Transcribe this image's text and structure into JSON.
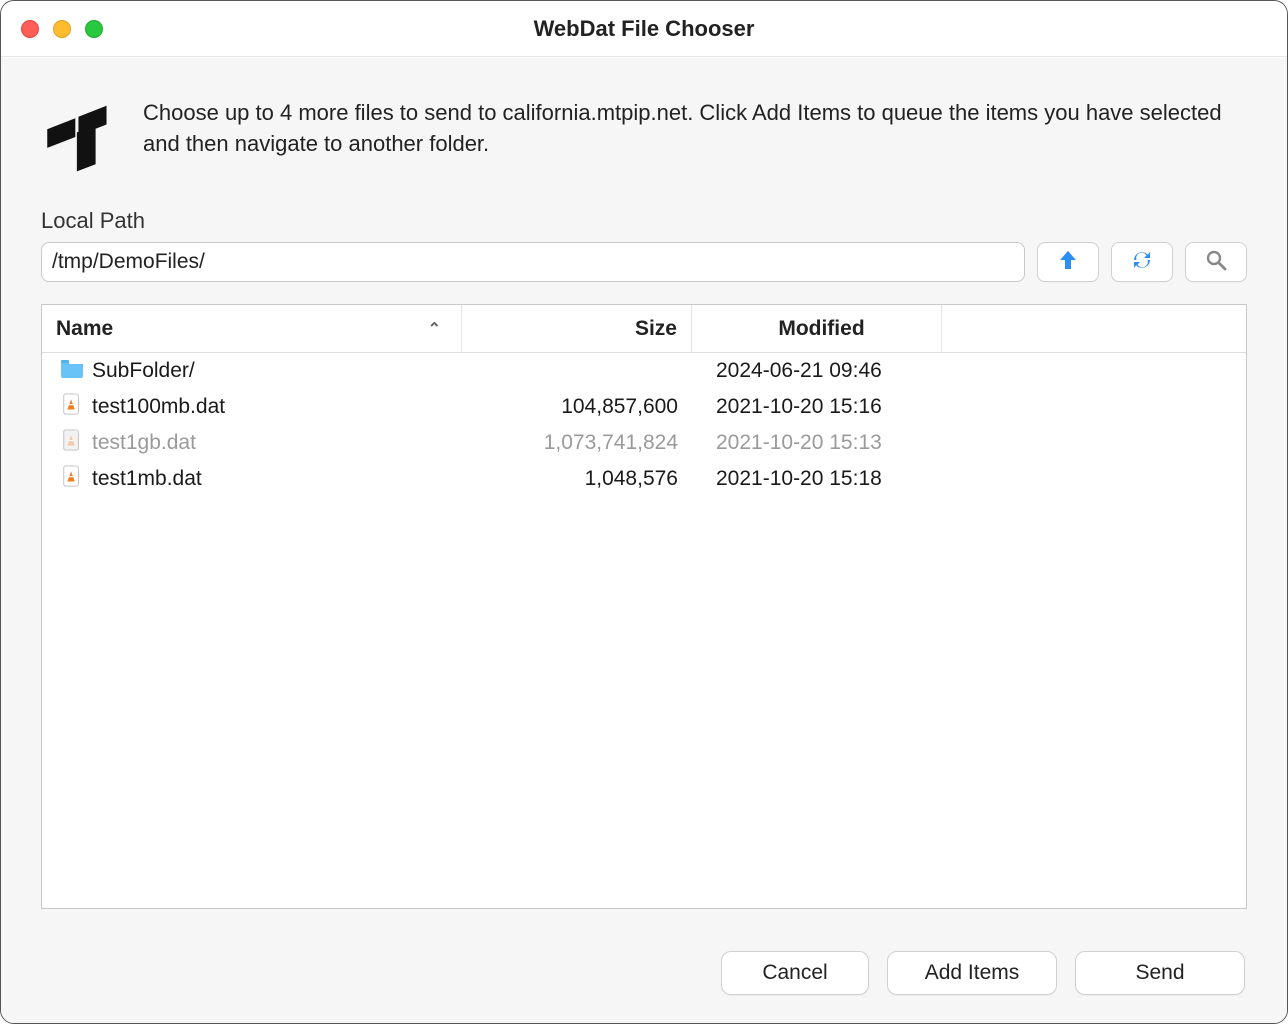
{
  "window": {
    "title": "WebDat File Chooser"
  },
  "description": "Choose up to 4 more files to send to california.mtpip.net.  Click Add Items to queue the items you have selected and then navigate to another folder.",
  "path": {
    "label": "Local Path",
    "value": "/tmp/DemoFiles/"
  },
  "toolbar_icons": {
    "up": "up-arrow-icon",
    "refresh": "refresh-icon",
    "search": "search-icon"
  },
  "table": {
    "columns": {
      "name": "Name",
      "size": "Size",
      "modified": "Modified"
    },
    "sort_column": "name",
    "sort_dir": "asc",
    "rows": [
      {
        "icon": "folder",
        "name": "SubFolder/",
        "size": "",
        "modified": "2024-06-21 09:46",
        "disabled": false
      },
      {
        "icon": "file",
        "name": "test100mb.dat",
        "size": "104,857,600",
        "modified": "2021-10-20 15:16",
        "disabled": false
      },
      {
        "icon": "file",
        "name": "test1gb.dat",
        "size": "1,073,741,824",
        "modified": "2021-10-20 15:13",
        "disabled": true
      },
      {
        "icon": "file",
        "name": "test1mb.dat",
        "size": "1,048,576",
        "modified": "2021-10-20 15:18",
        "disabled": false
      }
    ]
  },
  "buttons": {
    "cancel": "Cancel",
    "add_items": "Add Items",
    "send": "Send"
  },
  "colors": {
    "accent_blue": "#2a8ef4",
    "folder_blue": "#69c3f6",
    "cone_orange": "#f47c20"
  }
}
